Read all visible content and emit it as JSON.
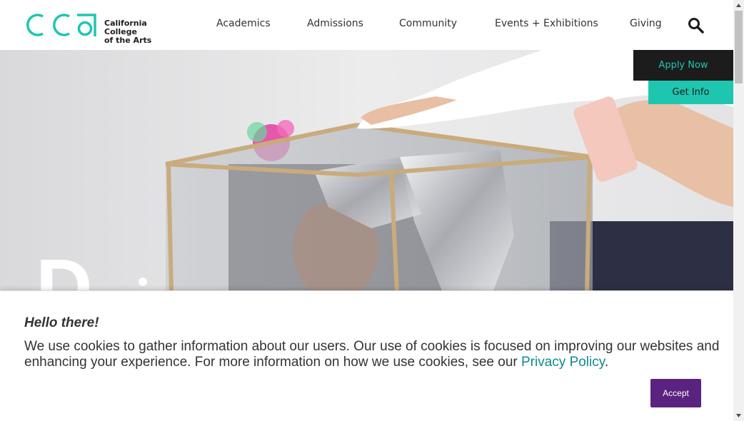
{
  "header": {
    "logo_text_line1": "California College",
    "logo_text_line2": "of the Arts",
    "nav": [
      "Academics",
      "Admissions",
      "Community",
      "Events + Exhibitions",
      "Giving"
    ]
  },
  "cta": {
    "apply": "Apply Now",
    "info": "Get Info"
  },
  "hero": {
    "photo": "student-building-reflective-box-with-phone"
  },
  "cookie": {
    "title": "Hello there!",
    "body": "We use cookies to gather information about our users. Our use of cookies is focused on improving our websites and enhancing your experience. For more information on how we use cookies, see our ",
    "link": "Privacy Policy",
    "end": ".",
    "accept": "Accept"
  },
  "colors": {
    "brand_teal": "#1ec6b0",
    "dark": "#1c1c1c",
    "accept_purple": "#5a2380",
    "link_teal": "#0e8a8a"
  }
}
